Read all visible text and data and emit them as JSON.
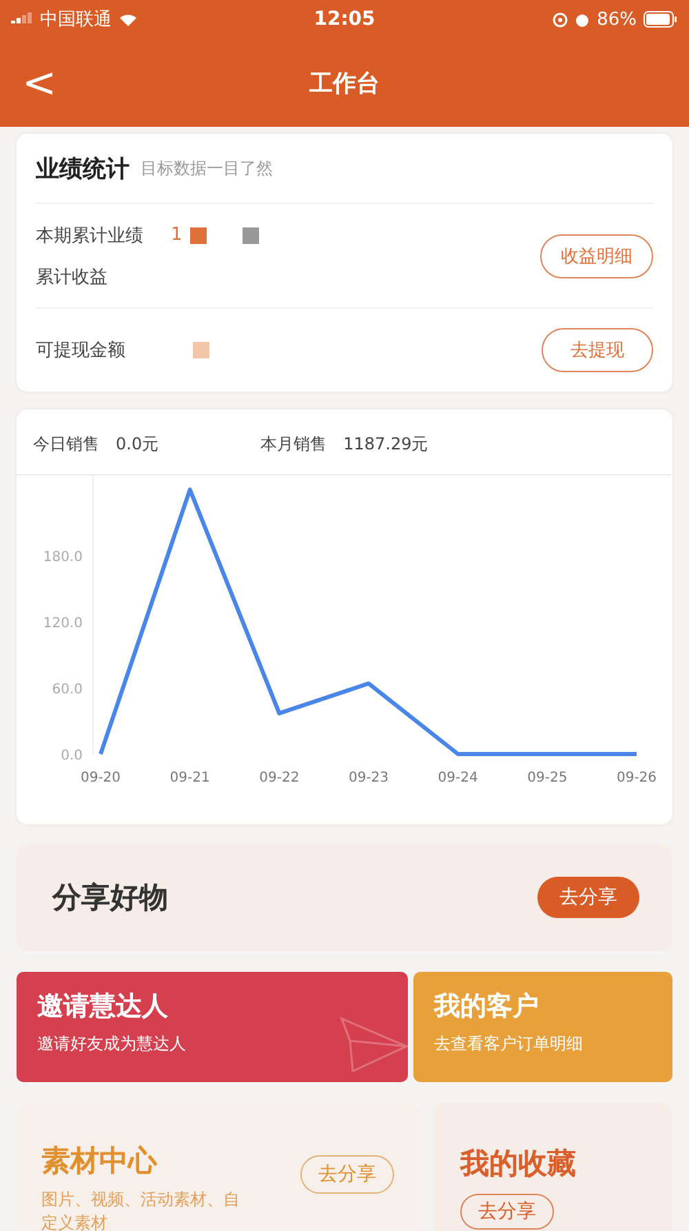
{
  "status_bar": {
    "carrier": "中国联通",
    "time": "12:05",
    "battery": "86%"
  },
  "nav": {
    "back": "<",
    "title": "工作台"
  },
  "performance": {
    "title": "业绩统计",
    "subtitle": "目标数据一目了然",
    "rows": [
      {
        "label": "本期累计业绩",
        "value": "1"
      },
      {
        "label": "累计收益"
      }
    ],
    "detail_button": "收益明细",
    "withdraw_label": "可提现金额",
    "withdraw_button": "去提现"
  },
  "sales": {
    "today_label": "今日销售",
    "today_value": "0.0元",
    "month_label": "本月销售",
    "month_value": "1187.29元",
    "chart_data": {
      "type": "line",
      "categories": [
        "09-20",
        "09-21",
        "09-22",
        "09-23",
        "09-24",
        "09-25",
        "09-26"
      ],
      "series": [
        {
          "color": "#4a86e8",
          "values": [
            0,
            240,
            37,
            64,
            0,
            0,
            0
          ]
        }
      ],
      "ylim": [
        0,
        254
      ],
      "yticks": [
        {
          "value": 0,
          "label": "0.0"
        },
        {
          "value": 60,
          "label": "60.0"
        },
        {
          "value": 120,
          "label": "120.0"
        },
        {
          "value": 180,
          "label": "180.0"
        }
      ]
    }
  },
  "share": {
    "title": "分享好物",
    "button": "去分享"
  },
  "tiles": [
    {
      "title": "邀请慧达人",
      "subtitle": "邀请好友成为慧达人",
      "color": "#d5404f"
    },
    {
      "title": "我的客户",
      "subtitle": "去查看客户订单明细",
      "color": "#e7a03a"
    }
  ],
  "materials": {
    "title": "素材中心",
    "subtitle": "图片、视频、活动素材、自定义素材",
    "button": "去分享"
  },
  "favorites": {
    "title": "我的收藏",
    "button": "去分享"
  }
}
